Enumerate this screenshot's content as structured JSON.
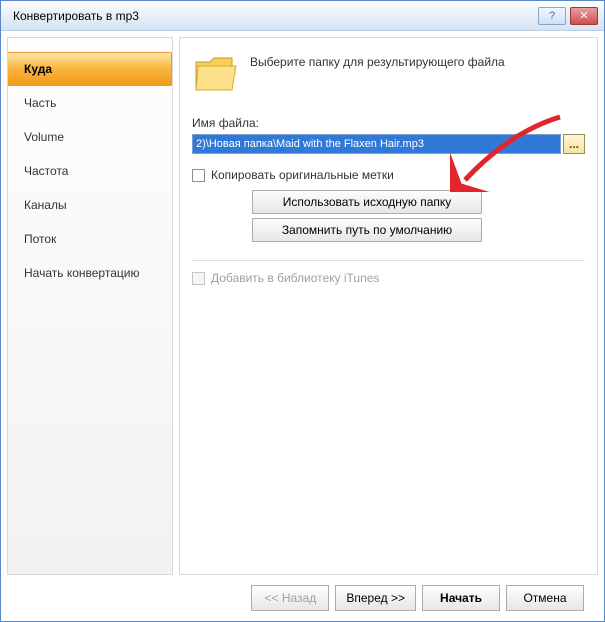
{
  "window": {
    "title": "Конвертировать в mp3"
  },
  "sidebar": {
    "items": [
      {
        "label": "Куда"
      },
      {
        "label": "Часть"
      },
      {
        "label": "Volume"
      },
      {
        "label": "Частота"
      },
      {
        "label": "Каналы"
      },
      {
        "label": "Поток"
      },
      {
        "label": "Начать конвертацию"
      }
    ]
  },
  "main": {
    "header_text": "Выберите папку для результирующего файла",
    "filename_label": "Имя файла:",
    "filename_value": "2)\\Новая папка\\Maid with the Flaxen Hair.mp3",
    "browse_label": "...",
    "copy_tags_label": "Копировать оригинальные метки",
    "use_source_folder_label": "Использовать исходную папку",
    "remember_path_label": "Запомнить путь по умолчанию",
    "add_itunes_label": "Добавить в библиотеку iTunes"
  },
  "footer": {
    "back_label": "<< Назад",
    "next_label": "Вперед >>",
    "start_label": "Начать",
    "cancel_label": "Отмена"
  }
}
